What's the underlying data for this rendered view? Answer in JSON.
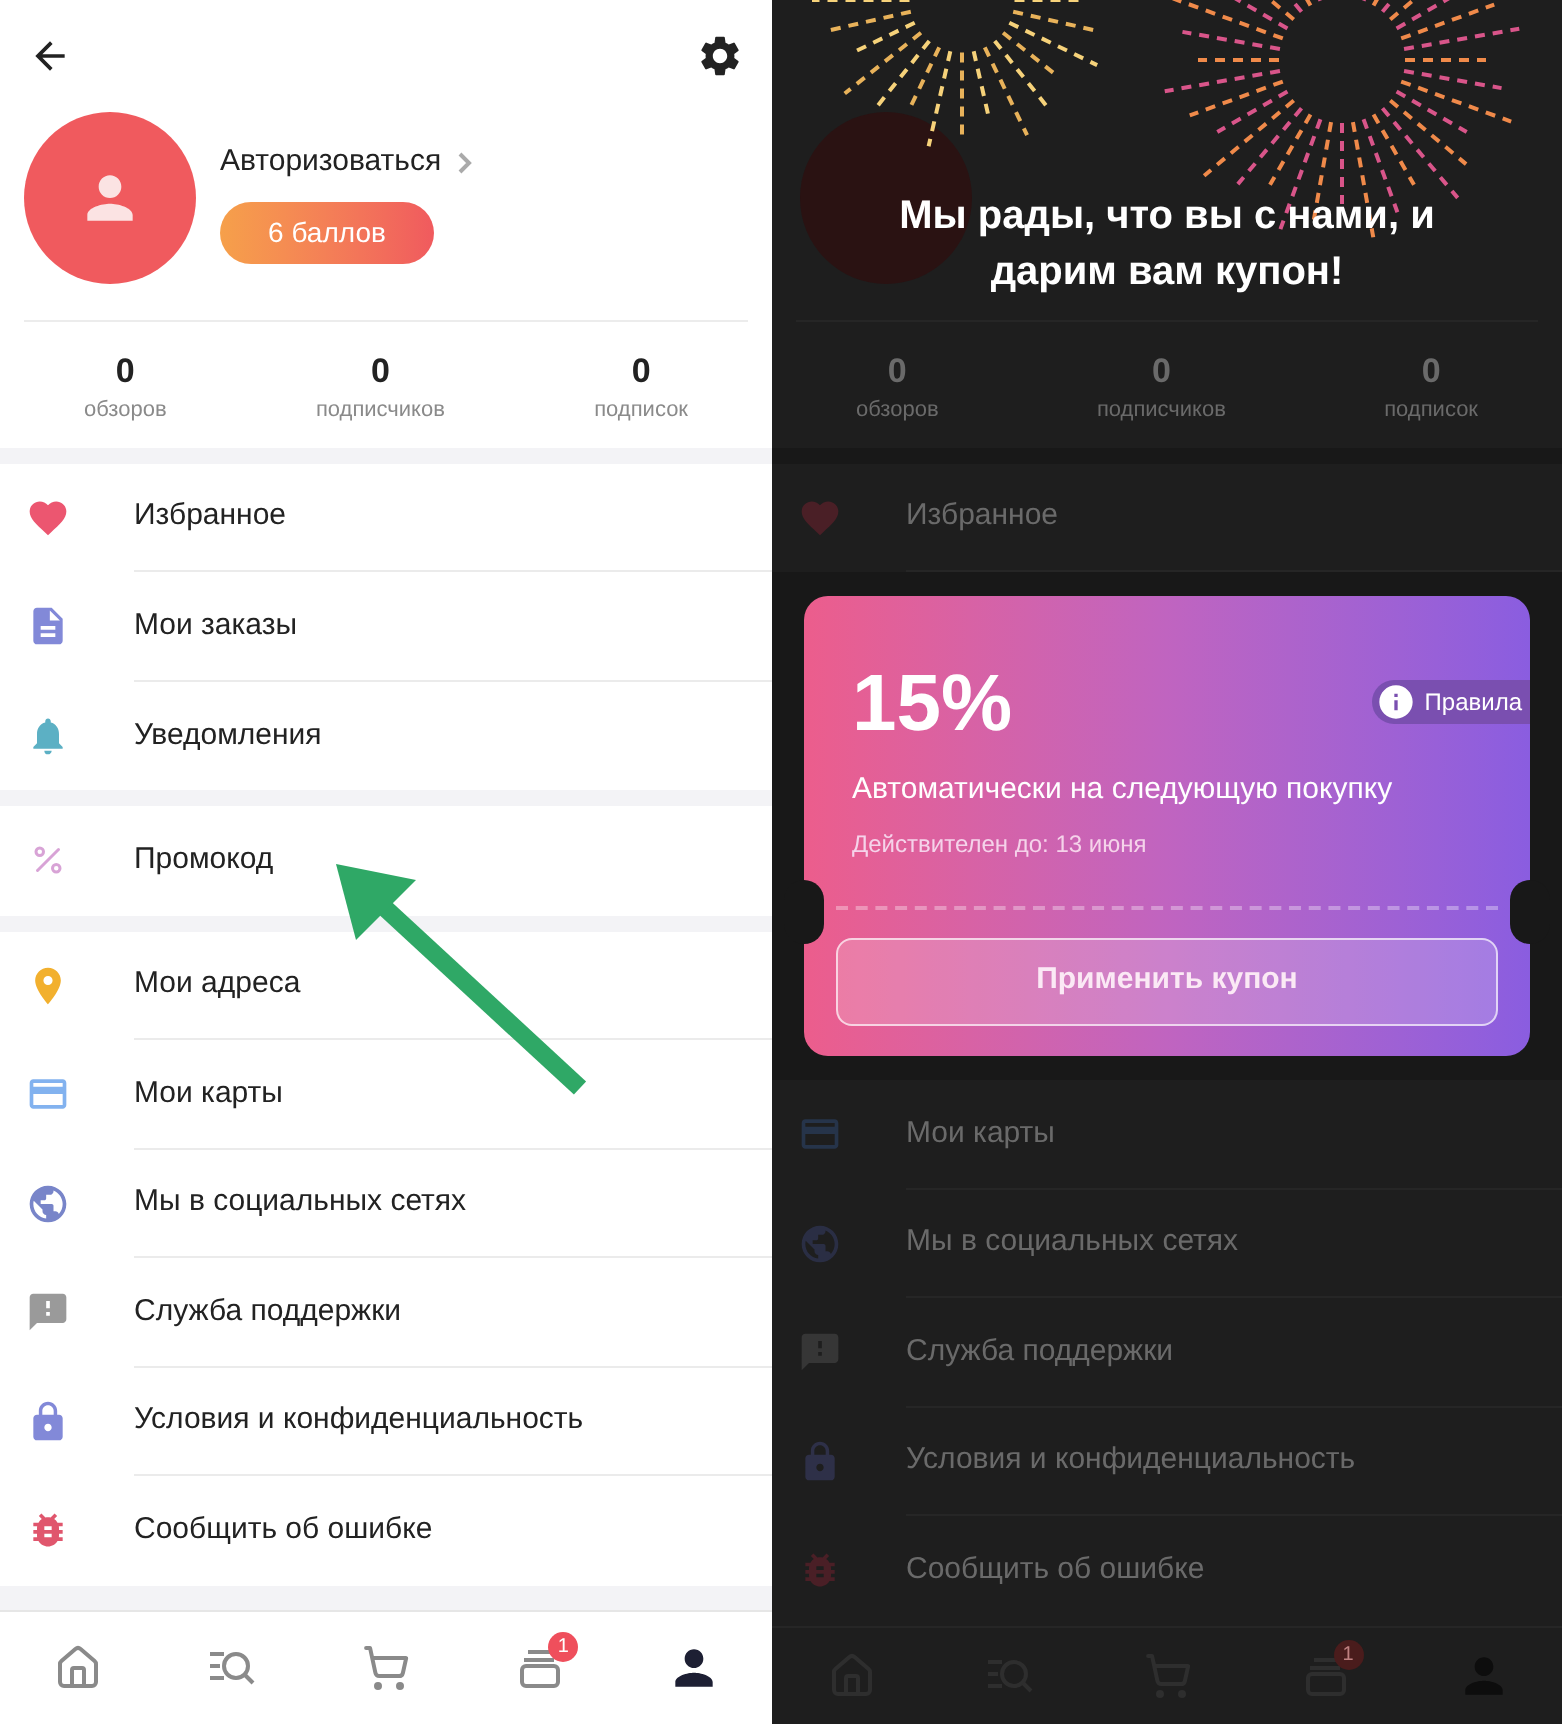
{
  "left_screen": {
    "profile": {
      "login_link": "Авторизоваться",
      "points": "6 баллов"
    },
    "stats": [
      {
        "value": "0",
        "label": "обзоров"
      },
      {
        "value": "0",
        "label": "подписчиков"
      },
      {
        "value": "0",
        "label": "подписок"
      }
    ],
    "menu_groups": [
      [
        {
          "kind": "heart",
          "label": "Избранное"
        },
        {
          "kind": "orders",
          "label": "Мои заказы"
        },
        {
          "kind": "bell",
          "label": "Уведомления"
        }
      ],
      [
        {
          "kind": "percent",
          "label": "Промокод"
        }
      ],
      [
        {
          "kind": "pin",
          "label": "Мои адреса"
        },
        {
          "kind": "card",
          "label": "Мои карты"
        },
        {
          "kind": "globe",
          "label": "Мы в социальных сетях"
        },
        {
          "kind": "support",
          "label": "Служба поддержки"
        },
        {
          "kind": "lock",
          "label": "Условия и конфиденциальность"
        },
        {
          "kind": "bug",
          "label": "Сообщить об ошибке"
        }
      ]
    ],
    "bottom_nav": [
      {
        "kind": "home",
        "selected": false
      },
      {
        "kind": "catalog",
        "selected": false
      },
      {
        "kind": "cart",
        "selected": false
      },
      {
        "kind": "cards",
        "badge": "1",
        "selected": false
      },
      {
        "kind": "person",
        "selected": true
      }
    ]
  },
  "right_screen": {
    "headline": "Мы рады, что вы с нами, и дарим вам купон!",
    "stats": [
      {
        "value": "0",
        "label": "обзоров"
      },
      {
        "value": "0",
        "label": "подписчиков"
      },
      {
        "value": "0",
        "label": "подписок"
      }
    ],
    "menu_above": [
      {
        "kind": "heart",
        "label": "Избранное"
      }
    ],
    "coupon": {
      "discount": "15%",
      "rules": "Правила",
      "description": "Автоматически на следующую покупку",
      "valid_until": "Действителен до: 13 июня",
      "apply_button": "Применить купон"
    },
    "menu_below": [
      {
        "kind": "card",
        "label": "Мои карты"
      },
      {
        "kind": "globe",
        "label": "Мы в социальных сетях"
      },
      {
        "kind": "support",
        "label": "Служба поддержки"
      },
      {
        "kind": "lock",
        "label": "Условия и конфиденциальность"
      },
      {
        "kind": "bug",
        "label": "Сообщить об ошибке"
      }
    ],
    "bottom_nav": [
      {
        "kind": "home",
        "selected": false
      },
      {
        "kind": "catalog",
        "selected": false
      },
      {
        "kind": "cart",
        "selected": false
      },
      {
        "kind": "cards",
        "badge": "1",
        "selected": false
      },
      {
        "kind": "person",
        "selected": true
      }
    ]
  }
}
